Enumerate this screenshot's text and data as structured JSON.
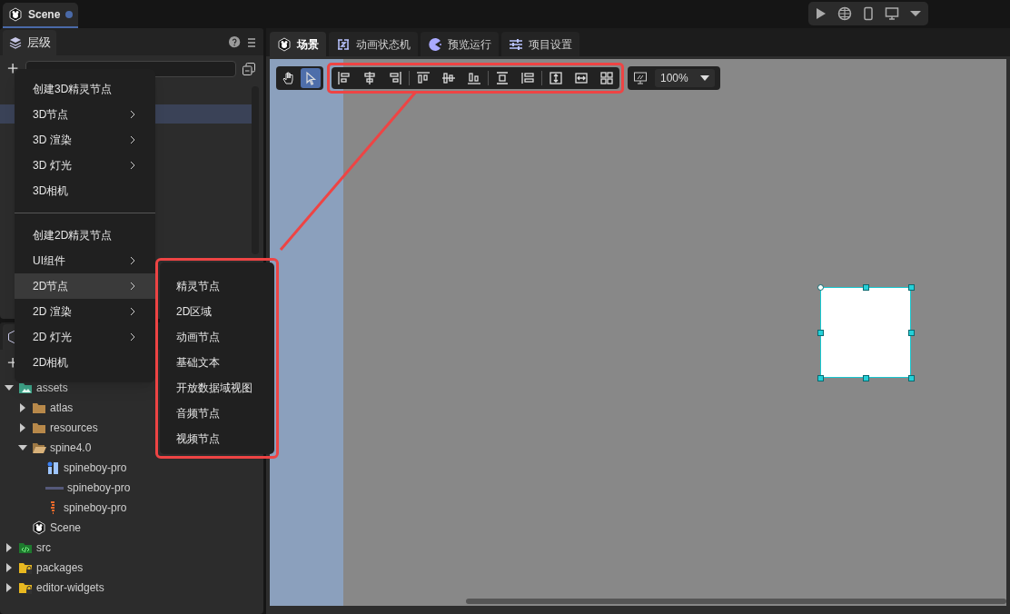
{
  "document_tab": {
    "title": "Scene",
    "modified": true
  },
  "hierarchy": {
    "tab": "层级"
  },
  "context_menu": {
    "items": [
      {
        "kind": "item",
        "label": "创建3D精灵节点",
        "submenu": false,
        "selected": false
      },
      {
        "kind": "item",
        "label": "3D节点",
        "submenu": true,
        "selected": false
      },
      {
        "kind": "item",
        "label": "3D 渲染",
        "submenu": true,
        "selected": false
      },
      {
        "kind": "item",
        "label": "3D 灯光",
        "submenu": true,
        "selected": false
      },
      {
        "kind": "item",
        "label": "3D相机",
        "submenu": false,
        "selected": false
      },
      {
        "kind": "separator"
      },
      {
        "kind": "item",
        "label": "创建2D精灵节点",
        "submenu": false,
        "selected": false
      },
      {
        "kind": "item",
        "label": "UI组件",
        "submenu": true,
        "selected": false
      },
      {
        "kind": "item",
        "label": "2D节点",
        "submenu": true,
        "selected": true
      },
      {
        "kind": "item",
        "label": "2D 渲染",
        "submenu": true,
        "selected": false
      },
      {
        "kind": "item",
        "label": "2D 灯光",
        "submenu": true,
        "selected": false
      },
      {
        "kind": "item",
        "label": "2D相机",
        "submenu": false,
        "selected": false
      }
    ],
    "submenu": [
      "精灵节点",
      "2D区域",
      "动画节点",
      "基础文本",
      "开放数据域视图",
      "音频节点",
      "视频节点"
    ]
  },
  "assets": [
    {
      "kind": "assets-folder",
      "label": "assets",
      "expanded": true,
      "children": [
        {
          "kind": "folder",
          "label": "atlas",
          "expanded": false
        },
        {
          "kind": "folder",
          "label": "resources",
          "expanded": false
        },
        {
          "kind": "open-folder",
          "label": "spine4.0",
          "expanded": true,
          "children": [
            {
              "kind": "skeleton",
              "label": "spineboy-pro"
            },
            {
              "kind": "atlas",
              "label": "spineboy-pro"
            },
            {
              "kind": "texture",
              "label": "spineboy-pro"
            }
          ]
        },
        {
          "kind": "scene",
          "label": "Scene"
        }
      ]
    },
    {
      "kind": "code-folder",
      "label": "src",
      "expanded": false
    },
    {
      "kind": "locked-folder",
      "label": "packages",
      "expanded": false
    },
    {
      "kind": "locked-folder",
      "label": "editor-widgets",
      "expanded": false
    }
  ],
  "editor_tabs": [
    {
      "kind": "scene",
      "label": "场景",
      "selected": true
    },
    {
      "kind": "animator",
      "label": "动画状态机",
      "selected": false
    },
    {
      "kind": "preview",
      "label": "预览运行",
      "selected": false
    },
    {
      "kind": "settings",
      "label": "项目设置",
      "selected": false
    }
  ],
  "tools": [
    {
      "kind": "hand",
      "selected": false
    },
    {
      "kind": "pointer",
      "selected": true
    }
  ],
  "zoom": "100%"
}
